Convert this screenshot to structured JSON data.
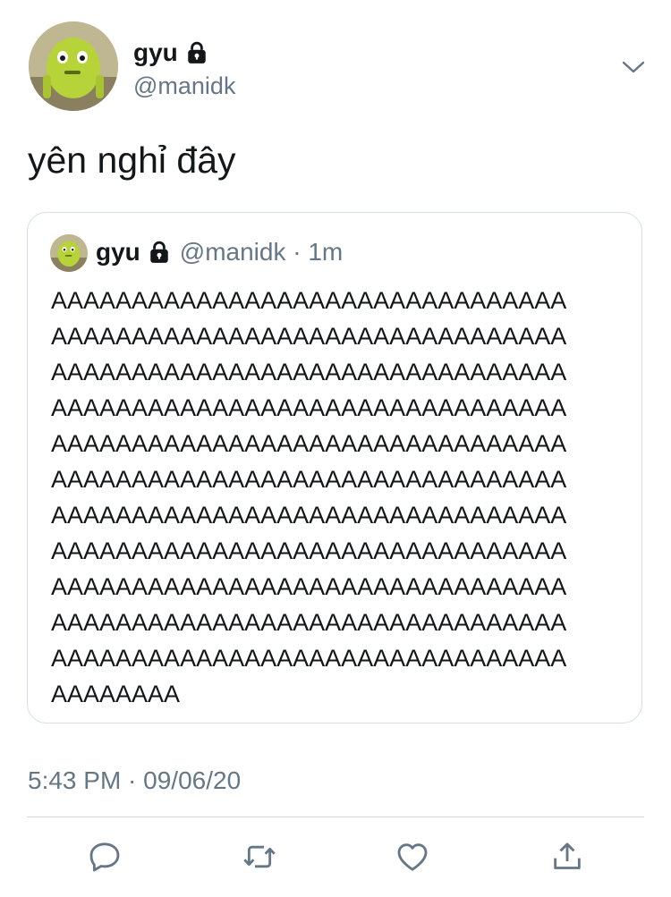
{
  "author": {
    "display_name": "gyu",
    "handle": "@manidk",
    "avatar_icon": "mike-wazowski-avatar",
    "locked_icon": "lock-icon"
  },
  "tweet": {
    "text": "yên nghỉ đây",
    "timestamp": "5:43 PM · 09/06/20"
  },
  "quoted_tweet": {
    "display_name": "gyu",
    "handle": "@manidk",
    "age": "1m",
    "lines": [
      "AAAAAAAAAAAAAAAAAAAAAAAAAAAAAAAA",
      "AAAAAAAAAAAAAAAAAAAAAAAAAAAAAAAA",
      "AAAAAAAAAAAAAAAAAAAAAAAAAAAAAAAA",
      "AAAAAAAAAAAAAAAAAAAAAAAAAAAAAAAA",
      "AAAAAAAAAAAAAAAAAAAAAAAAAAAAAAAA",
      "AAAAAAAAAAAAAAAAAAAAAAAAAAAAAAAA",
      "AAAAAAAAAAAAAAAAAAAAAAAAAAAAAAAA",
      "AAAAAAAAAAAAAAAAAAAAAAAAAAAAAAAA",
      "AAAAAAAAAAAAAAAAAAAAAAAAAAAAAAAA",
      "AAAAAAAAAAAAAAAAAAAAAAAAAAAAAAAA",
      "AAAAAAAAAAAAAAAAAAAAAAAAAAAAAAAA",
      "AAAAAAAA"
    ]
  },
  "actions": [
    {
      "name": "reply-icon"
    },
    {
      "name": "retweet-icon"
    },
    {
      "name": "like-icon"
    },
    {
      "name": "share-icon"
    }
  ],
  "colors": {
    "text": "#14171a",
    "secondary": "#657786",
    "border": "#d8dee3",
    "icon": "#657786"
  }
}
